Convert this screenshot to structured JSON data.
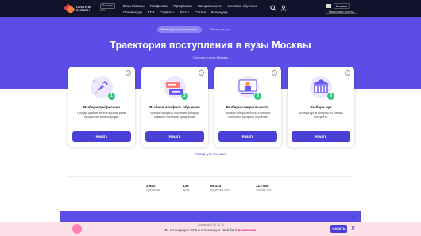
{
  "header": {
    "logo_text_1": "ПОСТУПИ",
    "logo_text_2": "ОНЛАЙН",
    "badge_top": "Логотип",
    "badge_bottom": "2GL",
    "nav_row1": [
      "Вузы Москвы",
      "Профессии",
      "Программы",
      "Специальности",
      "Целевое обучение"
    ],
    "nav_row2": [
      "Олимпиады",
      "ЕГЭ",
      "Сервисы",
      "Тесты",
      "Статьи",
      "Календарь"
    ],
    "city": "Москва",
    "add_button": "Настроить Access",
    "icons": [
      "search-icon",
      "user-icon"
    ]
  },
  "hero": {
    "tabs": [
      {
        "label": "Бакалавриат, специалитет",
        "active": true
      },
      {
        "label": "Магистратура",
        "active": false
      }
    ],
    "title": "Траектория поступления в вузы Москвы",
    "subtitle": "Поступи в вузы Москвы"
  },
  "steps": [
    {
      "number": "1",
      "title": "Выбери профессию",
      "text": "Пройди один из тестов и узнай какая профессия тебе подходит",
      "button": "Начать",
      "art": "rocket-icon",
      "info": "i"
    },
    {
      "number": "2",
      "title": "Выбери профиль обучения",
      "text": "Выбери профиль обучения, который позволит получить профессию.",
      "button": "Начать",
      "art": "chat-icon",
      "info": "i"
    },
    {
      "number": "3",
      "title": "Выбери специальность",
      "text": "Выбери специальность, к которой относится профиль обучения",
      "button": "Начать",
      "art": "teacher-icon",
      "info": "i"
    },
    {
      "number": "4",
      "title": "Выбери вуз",
      "text": "Выбери вуз, в котором ты хочешь поступить.",
      "button": "Начать",
      "art": "university-icon",
      "info": "i"
    }
  ],
  "expand_link": "Развернуть все шаги",
  "stats": [
    {
      "value": "2 692",
      "label": "программы"
    },
    {
      "value": "138",
      "label": "вузов"
    },
    {
      "value": "66 324",
      "label": "бюджетных мест"
    },
    {
      "value": "323 608",
      "label": "платных мест"
    }
  ],
  "promo": {
    "small": "Осталось: 0 : 0 : 0 : 0",
    "main": "ИИ сгенерирует ЕГЭ и сгенерирует твой бал!",
    "highlight": "Бесплатно!",
    "button": "НАЧАТЬ",
    "close": "✕"
  },
  "colors": {
    "brand": "#5b4ee6",
    "button": "#4a3fd6",
    "success": "#2fc57e",
    "topbar": "#12122a"
  }
}
